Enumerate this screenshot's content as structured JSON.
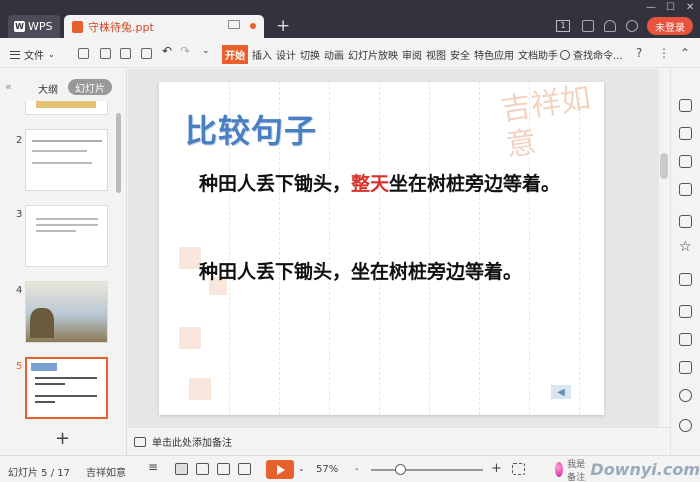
{
  "titlebar": {
    "wps_tab": "WPS",
    "doc_tab": "守株待兔.ppt",
    "new_tab": "+",
    "badge": "1",
    "login": "未登录"
  },
  "toolbar": {
    "file_menu": "文件",
    "tabs": [
      "开始",
      "插入",
      "设计",
      "切换",
      "动画",
      "幻灯片放映",
      "审阅",
      "视图",
      "安全",
      "特色应用",
      "文档助手"
    ],
    "active_tab": "开始",
    "search": "查找命令...",
    "help": "?",
    "more": "⋮",
    "collapse": "⌃"
  },
  "left_panel": {
    "collapse": "«",
    "tab_outline": "大纲",
    "tab_slides": "幻灯片",
    "thumbnails": [
      {
        "num": "2"
      },
      {
        "num": "3"
      },
      {
        "num": "4"
      },
      {
        "num": "5"
      }
    ],
    "add": "+"
  },
  "slide": {
    "title": "比较句子",
    "para1_before": "种田人丢下锄头，",
    "para1_highlight": "整天",
    "para1_after": "坐在树桩旁边等着。",
    "para2": "种田人丢下锄头，坐在树桩旁边等着。",
    "back_button": "◀",
    "seal_text": "吉祥如意"
  },
  "notes": {
    "placeholder": "单击此处添加备注"
  },
  "status": {
    "slide_counter": "幻灯片 5 / 17",
    "theme": "吉祥如意",
    "zoom": "57%",
    "zoom_minus": "-",
    "zoom_plus": "+",
    "zoom_fraction": 0.57,
    "watermark": "Downyi.com",
    "watermark_sub": "我是备注"
  },
  "colors": {
    "accent": "#e8612c",
    "title_blue": "#4a7fc1",
    "highlight_red": "#d7332b",
    "titlebar": "#33333d"
  }
}
